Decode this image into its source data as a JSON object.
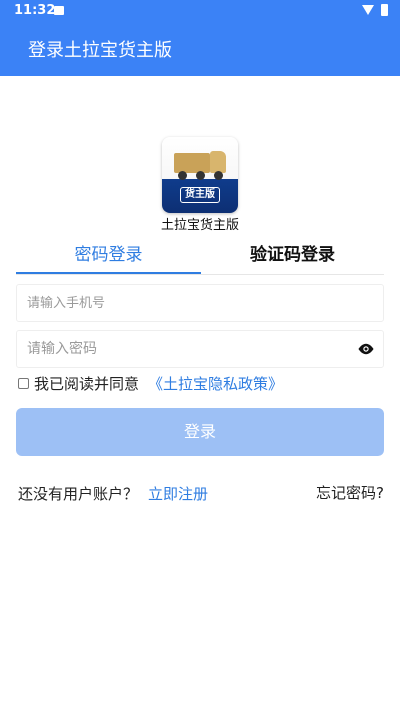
{
  "status_bar": {
    "time": "11:32"
  },
  "app_bar": {
    "title": "登录土拉宝货主版"
  },
  "logo": {
    "badge_text": "货主版",
    "caption": "土拉宝货主版"
  },
  "tabs": [
    {
      "label": "密码登录",
      "active": true
    },
    {
      "label": "验证码登录",
      "active": false
    }
  ],
  "form": {
    "phone_placeholder": "请输入手机号",
    "phone_value": "",
    "password_placeholder": "请输入密码",
    "password_value": ""
  },
  "agreement": {
    "checked": false,
    "text": "我已阅读并同意",
    "link": "《土拉宝隐私政策》"
  },
  "login_button": {
    "label": "登录"
  },
  "footer": {
    "register_prompt": "还没有用户账户？",
    "register_link": "立即注册",
    "forgot_password": "忘记密码?"
  },
  "colors": {
    "primary": "#3b82f6",
    "tab_active": "#2f7de1",
    "login_button_disabled": "#9dc0f5"
  },
  "icons": [
    "wifi-icon",
    "battery-icon",
    "notification-icon",
    "eye-icon",
    "truck-icon"
  ]
}
